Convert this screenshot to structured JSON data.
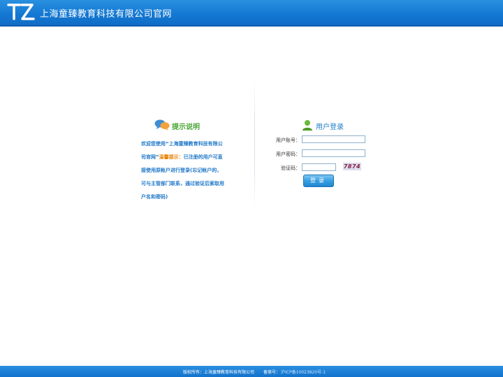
{
  "header": {
    "logo_text": "TZ",
    "site_title": "上海童臻教育科技有限公司官网"
  },
  "tips": {
    "title": "提示说明",
    "line1": "欢迎您使用“上海童臻教育科技有限公",
    "line2_pre": "司官网”",
    "line2_hl": "温馨提示：",
    "line2_post": "已注册的用户可直",
    "line3": "接使用原帐户进行登录(忘记帐户的，",
    "line4": "可与主管部门联系，通过验证后索取用",
    "line5": "户名和密码)"
  },
  "login": {
    "title": "用户登录",
    "username_label": "用户账号：",
    "username_value": "",
    "password_label": "用户密码：",
    "password_value": "",
    "captcha_label": "验证码：",
    "captcha_value": "",
    "captcha_image_text": "7874",
    "submit_label": "登录"
  },
  "footer": {
    "copyright": "版权所有：上海童臻教育科技有限公司",
    "icp_label": "备案号：",
    "icp_number": "沪ICP备10023820号-1"
  },
  "colors": {
    "header_blue": "#1479d3",
    "tip_green": "#4fa83a",
    "tip_blue": "#1f78c8",
    "highlight_orange": "#e67e00"
  }
}
